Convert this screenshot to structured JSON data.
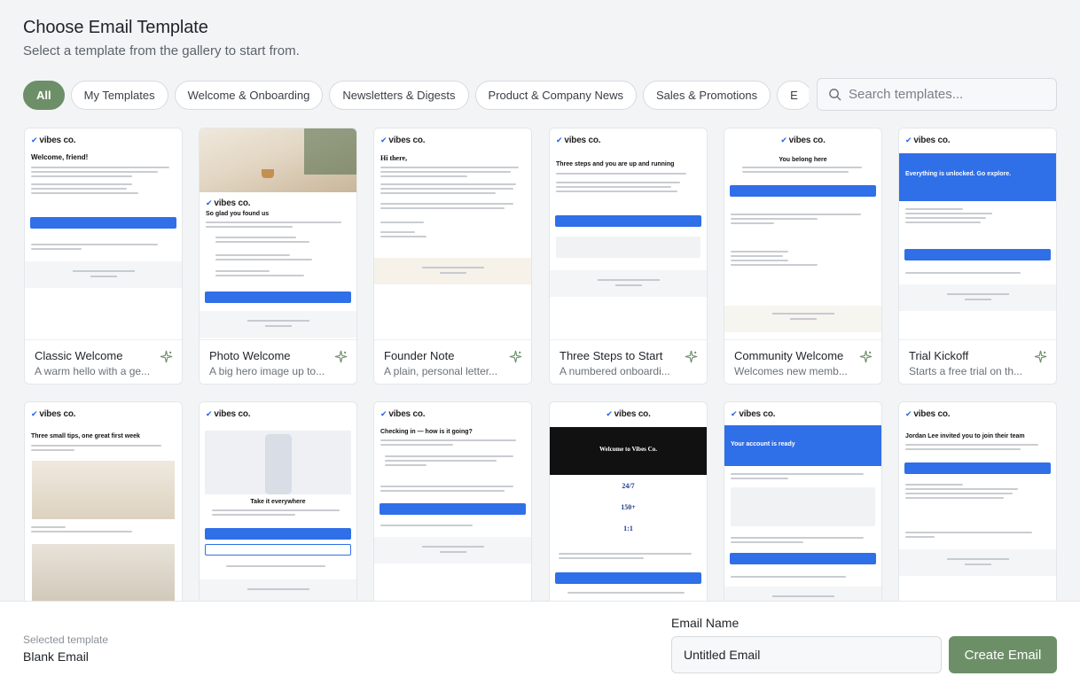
{
  "dialog": {
    "title": "Choose Email Template",
    "subtitle": "Select a template from the gallery to start from."
  },
  "filters": [
    {
      "label": "All",
      "active": true
    },
    {
      "label": "My Templates",
      "active": false
    },
    {
      "label": "Welcome & Onboarding",
      "active": false
    },
    {
      "label": "Newsletters & Digests",
      "active": false
    },
    {
      "label": "Product & Company News",
      "active": false
    },
    {
      "label": "Sales & Promotions",
      "active": false
    },
    {
      "label": "E",
      "active": false
    }
  ],
  "search": {
    "placeholder": "Search templates...",
    "icon": "search-icon"
  },
  "templates": [
    {
      "name": "Classic Welcome",
      "desc": "A warm hello with a ge..."
    },
    {
      "name": "Photo Welcome",
      "desc": "A big hero image up to..."
    },
    {
      "name": "Founder Note",
      "desc": "A plain, personal letter..."
    },
    {
      "name": "Three Steps to Start",
      "desc": "A numbered onboardi..."
    },
    {
      "name": "Community Welcome",
      "desc": "Welcomes new memb..."
    },
    {
      "name": "Trial Kickoff",
      "desc": "Starts a free trial on th..."
    }
  ],
  "previews": {
    "brand": "vibes co.",
    "classic_heading": "Welcome, friend!",
    "photo_heading": "So glad you found us",
    "founder_heading": "Hi there,",
    "steps_heading": "Three steps and you are up and running",
    "community_heading": "You belong here",
    "trial_heading": "Everything is unlocked. Go explore.",
    "tips_heading": "Three small tips, one great first week",
    "mobile_heading": "Take it everywhere",
    "checkin_heading": "Checking in — how is it going?",
    "membership_heading": "Welcome to Vibes Co.",
    "stat_1": "24/7",
    "stat_2": "150+",
    "stat_3": "1:1",
    "activation_heading": "Your account is ready",
    "invite_heading": "Jordan Lee invited you to join their team"
  },
  "footer": {
    "selected_label": "Selected template",
    "selected_value": "Blank Email",
    "name_label": "Email Name",
    "name_value": "Untitled Email",
    "create_label": "Create Email"
  },
  "colors": {
    "accent": "#6d8f68",
    "email_blue": "#2f6fe8"
  }
}
